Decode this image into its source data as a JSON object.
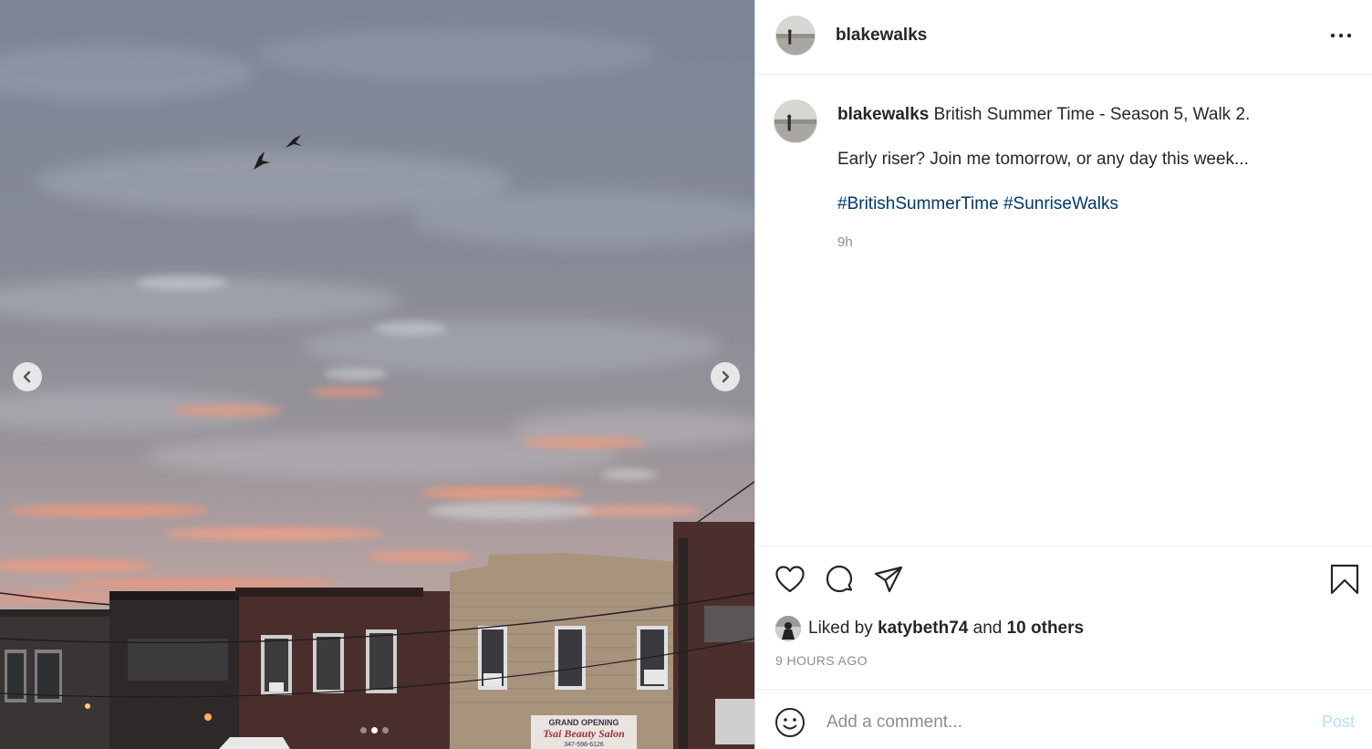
{
  "post": {
    "username": "blakewalks",
    "caption": {
      "username": "blakewalks",
      "title": "British Summer Time - Season 5, Walk 2.",
      "line2": "Early riser? Join me tomorrow, or any day this week...",
      "hashtags": [
        "#BritishSummerTime",
        "#SunriseWalks"
      ],
      "age": "9h"
    },
    "likes": {
      "prefix": "Liked by",
      "user": "katybeth74",
      "conjunction": "and",
      "others": "10 others"
    },
    "timestamp": "9 HOURS AGO",
    "comment": {
      "placeholder": "Add a comment...",
      "post_label": "Post"
    },
    "photo": {
      "sign_line1": "GRAND OPENING",
      "sign_line2": "Tsai Beauty Salon",
      "sign_line3": "347-598-6126"
    },
    "carousel": {
      "total": 3,
      "active_index": 1
    }
  },
  "icons": {
    "prev": "chevron-left-icon",
    "next": "chevron-right-icon",
    "more": "more-horizontal-icon",
    "like": "heart-icon",
    "comment": "comment-bubble-icon",
    "share": "paper-plane-icon",
    "save": "bookmark-icon",
    "emoji": "smiley-icon"
  },
  "colors": {
    "hashtag": "#00376b",
    "muted": "#8e8e8e",
    "post_button_disabled": "#b2dffc"
  }
}
